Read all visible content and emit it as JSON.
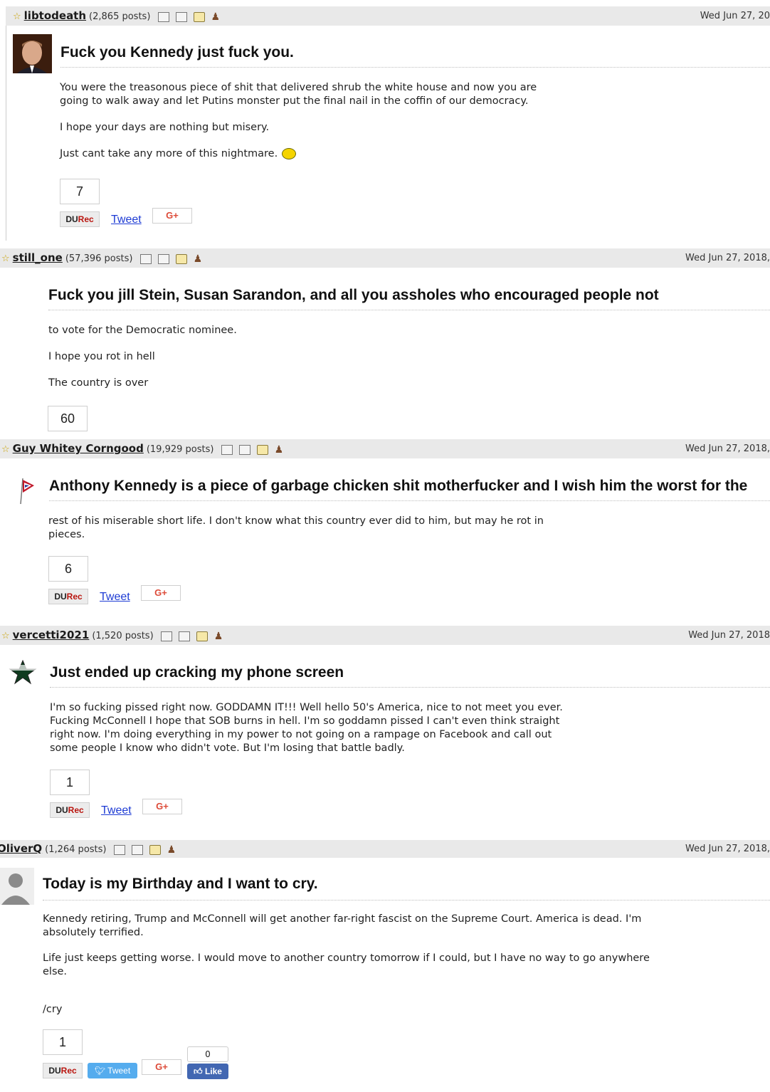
{
  "posts": [
    {
      "username": "libtodeath",
      "post_count": "(2,865 posts)",
      "date": "Wed Jun 27, 20",
      "title": "Fuck you Kennedy just fuck you.",
      "paragraphs": [
        "You were the treasonous piece of shit that delivered shrub the white house and now you are going to walk away and let Putins monster put the final nail in the coffin of our democracy.",
        "I hope your days are nothing but misery.",
        "Just cant take any more of this nightmare."
      ],
      "votes": "7",
      "durec_du": "DU",
      "durec_rec": "Rec",
      "tweet": "Tweet",
      "gplus": "G+"
    },
    {
      "username": "still_one",
      "post_count": "(57,396 posts)",
      "date": "Wed Jun 27, 2018,",
      "title": "Fuck you jill Stein, Susan Sarandon, and all you assholes who encouraged people not",
      "paragraphs": [
        "to vote for the Democratic nominee.",
        "I hope you rot in hell",
        "The country is over"
      ],
      "votes": "60"
    },
    {
      "username": "Guy Whitey Corngood",
      "post_count": "(19,929 posts)",
      "date": "Wed Jun 27, 2018,",
      "title": "Anthony Kennedy is a piece of garbage chicken shit motherfucker and I wish him the worst for the",
      "paragraphs": [
        "rest of his miserable short life. I don't know what this country ever did to him, but may he rot in pieces."
      ],
      "votes": "6",
      "durec_du": "DU",
      "durec_rec": "Rec",
      "tweet": "Tweet",
      "gplus": "G+"
    },
    {
      "username": "vercetti2021",
      "post_count": "(1,520 posts)",
      "date": "Wed Jun 27, 2018",
      "title": "Just ended up cracking my phone screen",
      "paragraphs": [
        "I'm so fucking pissed right now. GODDAMN IT!!! Well hello 50's America, nice to not meet you ever. Fucking McConnell I hope that SOB burns in hell. I'm so goddamn pissed I can't even think straight right now. I'm doing everything in my power to not going on a rampage on Facebook and call out some people I know who didn't vote. But I'm losing that battle badly."
      ],
      "votes": "1",
      "durec_du": "DU",
      "durec_rec": "Rec",
      "tweet": "Tweet",
      "gplus": "G+"
    },
    {
      "username": "OliverQ",
      "post_count": "(1,264 posts)",
      "date": "Wed Jun 27, 2018,",
      "title": "Today is my Birthday and I want to cry.",
      "paragraphs": [
        "Kennedy retiring, Trump and McConnell will get another far-right fascist on the Supreme Court. America is dead. I'm absolutely terrified.",
        "Life just keeps getting worse. I would move to another country tomorrow if I could, but I have no way to go anywhere else.",
        "/cry"
      ],
      "votes": "1",
      "durec_du": "DU",
      "durec_rec": "Rec",
      "tweet": "Tweet",
      "gplus": "G+",
      "like_count": "0",
      "like": "Like"
    }
  ],
  "icons": [
    "profile-icon",
    "journal-icon",
    "mail-icon",
    "ignore-icon"
  ],
  "colors": {
    "header_bg": "#e9e9e9",
    "rec_red": "#b9140e",
    "link_blue": "#1d3bd4",
    "tweet_blue": "#55acee",
    "like_blue": "#4267b2",
    "gplus_red": "#dd4b39"
  }
}
